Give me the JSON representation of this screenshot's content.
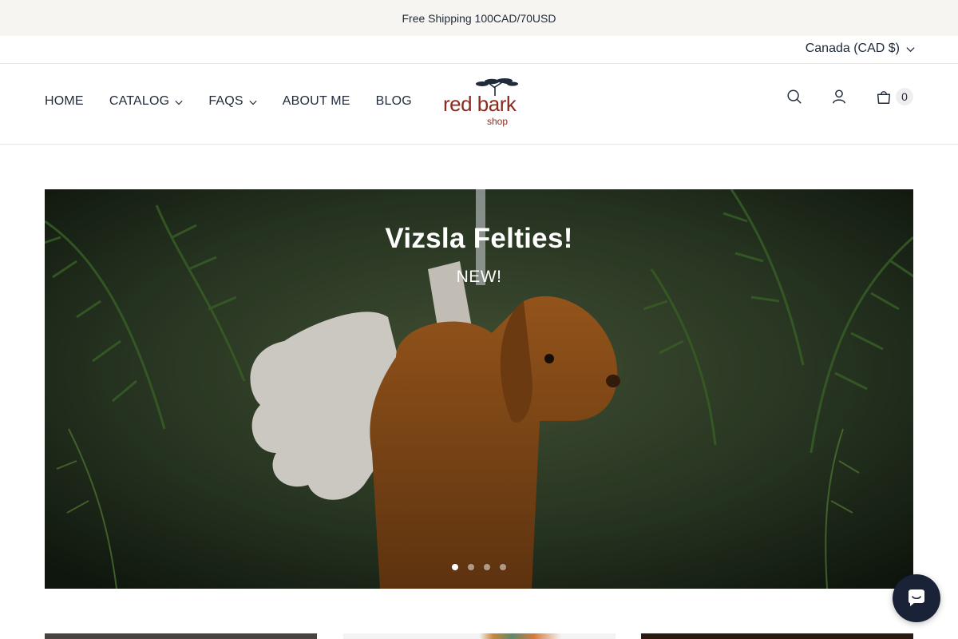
{
  "announcement": {
    "text": "Free Shipping 100CAD/70USD"
  },
  "currency": {
    "label": "Canada (CAD $)"
  },
  "nav": {
    "items": [
      {
        "label": "HOME",
        "dropdown": false
      },
      {
        "label": "CATALOG",
        "dropdown": true
      },
      {
        "label": "FAQS",
        "dropdown": true
      },
      {
        "label": "ABOUT ME",
        "dropdown": false
      },
      {
        "label": "BLOG",
        "dropdown": false
      }
    ]
  },
  "logo": {
    "main": "red bark",
    "sub": "shop"
  },
  "header": {
    "cart_count": "0",
    "icons": [
      "search-icon",
      "account-icon",
      "cart-icon"
    ]
  },
  "hero": {
    "title": "Vizsla Felties!",
    "subtitle": "NEW!",
    "slide_count": 4,
    "active_slide": 1
  },
  "colors": {
    "announcement_bg": "#f6f5f1",
    "text": "#1f2a3a",
    "logo": "#8b2a1f",
    "chat_button": "#1a2238"
  }
}
